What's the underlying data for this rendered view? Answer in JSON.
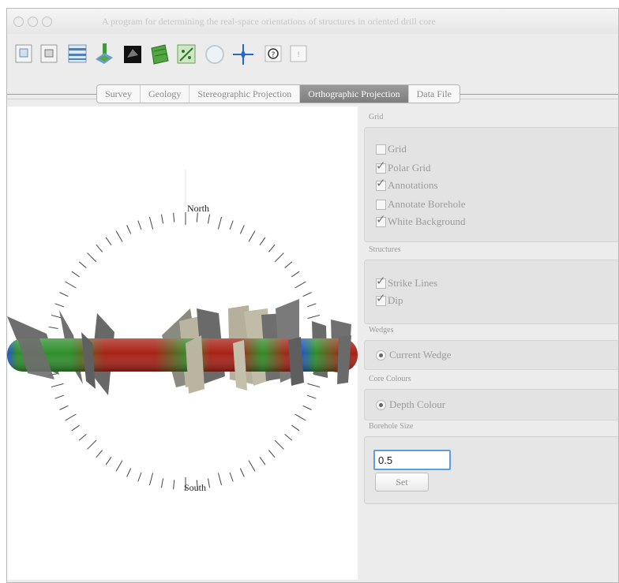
{
  "window": {
    "title": "A program for determining the real-space orientations of structures in oriented drill core"
  },
  "toolbar": {
    "icons": [
      "open-file-icon",
      "save-file-icon",
      "table-icon",
      "core-3d-icon",
      "black-square-icon",
      "green-map-icon",
      "green-plot-icon",
      "sphere-icon",
      "compass-star-icon",
      "help-icon",
      "info-icon"
    ]
  },
  "tabs": [
    "Survey",
    "Geology",
    "Stereographic Projection",
    "Orthographic Projection",
    "Data File"
  ],
  "active_tab": "Orthographic Projection",
  "plot": {
    "north_label": "North",
    "south_label": "South"
  },
  "panel": {
    "grid": {
      "title": "Grid",
      "options": [
        {
          "label": "Grid",
          "checked": false
        },
        {
          "label": "Polar Grid",
          "checked": true
        },
        {
          "label": "Annotations",
          "checked": true
        },
        {
          "label": "Annotate Borehole",
          "checked": false
        },
        {
          "label": "White Background",
          "checked": true
        }
      ]
    },
    "structures": {
      "title": "Structures",
      "options": [
        {
          "label": "Strike Lines",
          "checked": true
        },
        {
          "label": "Dip",
          "checked": true
        }
      ]
    },
    "wedges": {
      "title": "Wedges",
      "option": "Current Wedge"
    },
    "core_colours": {
      "title": "Core Colours",
      "option": "Depth Colour"
    },
    "borehole_size": {
      "title": "Borehole Size",
      "value": "0.5",
      "button": "Set"
    }
  },
  "colors": {
    "core_green": "#2f8f2b",
    "core_red": "#a82216",
    "core_blue": "#1f53c9",
    "plane_gray": "#6e6e6e",
    "plane_beige": "#b9b5a0",
    "input_focus": "#5d9de0"
  }
}
